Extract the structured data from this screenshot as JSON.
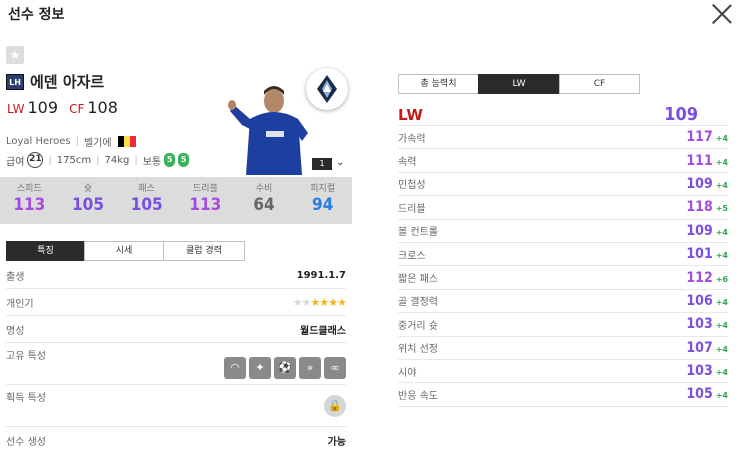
{
  "header": {
    "title": "선수 정보"
  },
  "player": {
    "position_badge": "LH",
    "name": "에덴 아자르",
    "ovr": [
      {
        "pos": "LW",
        "value": "109"
      },
      {
        "pos": "CF",
        "value": "108"
      }
    ],
    "season": "Loyal Heroes",
    "nation": "벨기에",
    "flag_colors": [
      "#000000",
      "#fae042",
      "#ed2939"
    ],
    "salary_label": "급여",
    "salary": "21",
    "height": "175cm",
    "weight": "74kg",
    "body_type": "보통",
    "feet": [
      "5",
      "5"
    ],
    "enhance_level": "1",
    "club_logo": "vancouver-whitecaps-crest-icon"
  },
  "stats": [
    {
      "label": "스피드",
      "value": "113",
      "color": "#a14ee0"
    },
    {
      "label": "슛",
      "value": "105",
      "color": "#7a4fe0"
    },
    {
      "label": "패스",
      "value": "105",
      "color": "#7a4fe0"
    },
    {
      "label": "드리블",
      "value": "113",
      "color": "#a14ee0"
    },
    {
      "label": "수비",
      "value": "64",
      "color": "#666666"
    },
    {
      "label": "피지컬",
      "value": "94",
      "color": "#2a7de1"
    }
  ],
  "left_tabs": [
    {
      "label": "특징",
      "active": true
    },
    {
      "label": "시세",
      "active": false
    },
    {
      "label": "클럽 경력",
      "active": false
    }
  ],
  "info": {
    "birth": {
      "label": "출생",
      "value": "1991.1.7"
    },
    "skill_moves": {
      "label": "개인기",
      "filled": 4,
      "total": 6
    },
    "reputation": {
      "label": "명성",
      "value": "월드클래스"
    },
    "traits": {
      "label": "고유 특성",
      "icons": [
        "finesse-shot-icon",
        "flair-icon",
        "dribbler-icon",
        "speed-dribbler-icon",
        "technical-dribbler-icon"
      ]
    },
    "acquired": {
      "label": "획득 특성"
    },
    "training": {
      "label": "선수 생성",
      "value": "가능"
    }
  },
  "right_tabs": [
    {
      "label": "총 능력치",
      "active": false
    },
    {
      "label": "LW",
      "active": true
    },
    {
      "label": "CF",
      "active": false
    }
  ],
  "attributes": {
    "position": {
      "label": "LW",
      "value": "109"
    },
    "rows": [
      {
        "label": "가속력",
        "value": "117",
        "bonus": "+4",
        "color": "#a14ee0"
      },
      {
        "label": "속력",
        "value": "111",
        "bonus": "+4",
        "color": "#a14ee0"
      },
      {
        "label": "민첩성",
        "value": "109",
        "bonus": "+4",
        "color": "#7a4fe0"
      },
      {
        "label": "드리블",
        "value": "118",
        "bonus": "+5",
        "color": "#a14ee0"
      },
      {
        "label": "볼 컨트롤",
        "value": "109",
        "bonus": "+4",
        "color": "#7a4fe0"
      },
      {
        "label": "크로스",
        "value": "101",
        "bonus": "+4",
        "color": "#7a4fe0"
      },
      {
        "label": "짧은 패스",
        "value": "112",
        "bonus": "+6",
        "color": "#a14ee0"
      },
      {
        "label": "골 결정력",
        "value": "106",
        "bonus": "+4",
        "color": "#7a4fe0"
      },
      {
        "label": "중거리 슛",
        "value": "103",
        "bonus": "+4",
        "color": "#7a4fe0"
      },
      {
        "label": "위치 선정",
        "value": "107",
        "bonus": "+4",
        "color": "#7a4fe0"
      },
      {
        "label": "시야",
        "value": "103",
        "bonus": "+4",
        "color": "#7a4fe0"
      },
      {
        "label": "반응 속도",
        "value": "105",
        "bonus": "+4",
        "color": "#7a4fe0"
      }
    ]
  }
}
